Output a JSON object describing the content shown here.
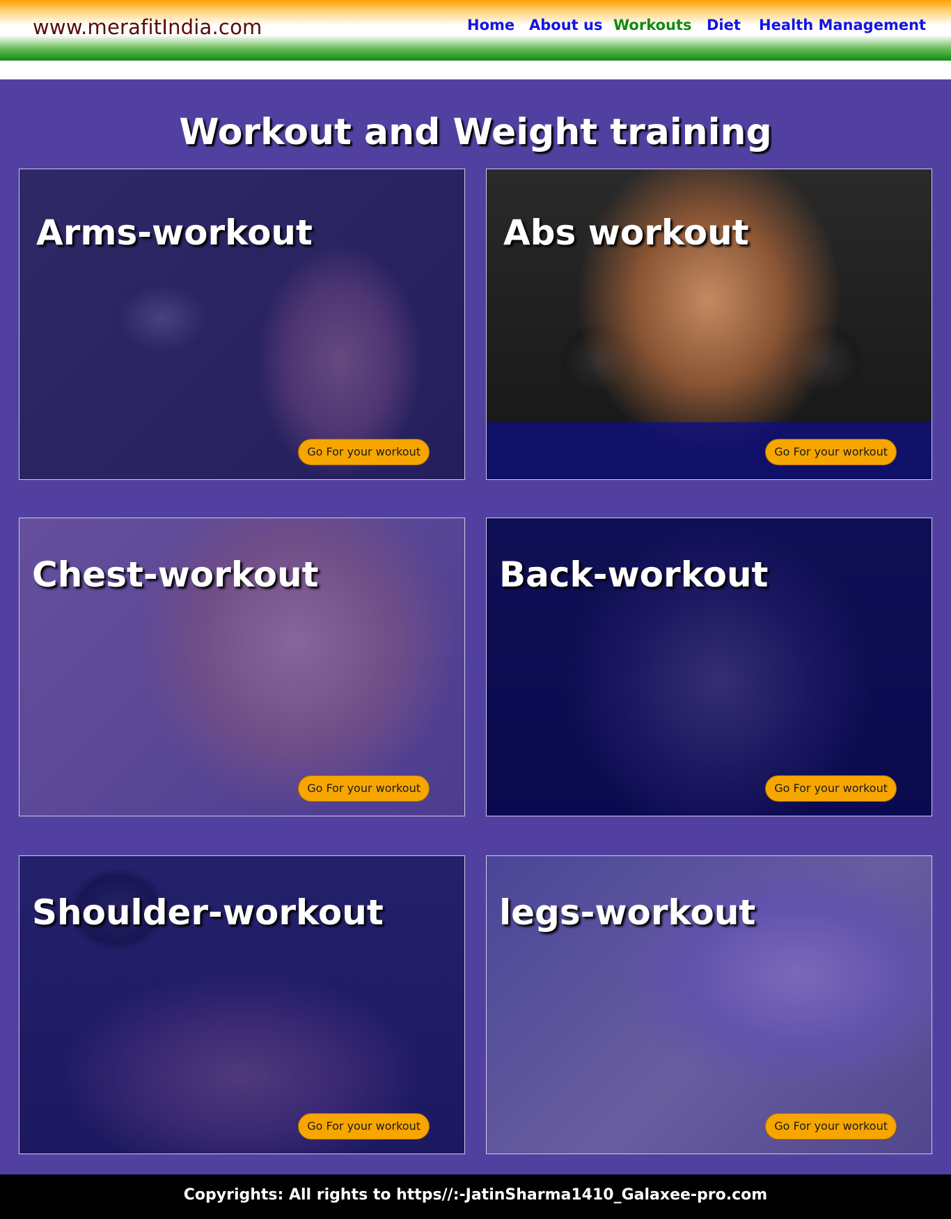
{
  "header": {
    "brand": "www.merafitIndia.com",
    "nav": [
      {
        "label": "Home",
        "active": false
      },
      {
        "label": "About us",
        "active": false
      },
      {
        "label": "Workouts",
        "active": true
      },
      {
        "label": "Diet",
        "active": false
      },
      {
        "label": "Health Management",
        "active": false
      }
    ]
  },
  "main": {
    "title": "Workout and Weight training",
    "cards": [
      {
        "title": "Arms-workout",
        "button": "Go For your workout"
      },
      {
        "title": "Abs workout",
        "button": "Go For your workout"
      },
      {
        "title": "Chest-workout",
        "button": "Go For your workout"
      },
      {
        "title": "Back-workout",
        "button": "Go For your workout"
      },
      {
        "title": "Shoulder-workout",
        "button": "Go For your workout"
      },
      {
        "title": "legs-workout",
        "button": "Go For your workout"
      }
    ]
  },
  "footer": {
    "text": "Copyrights: All rights to https//:-JatinSharma1410_Galaxee-pro.com"
  },
  "colors": {
    "header_saffron": "#ff9f00",
    "header_green": "#118a12",
    "nav_link": "#1414e6",
    "nav_active": "#118a12",
    "brand": "#5a0a0a",
    "main_bg": "#5240a0",
    "button_bg": "#f7a600",
    "footer_bg": "#000000"
  }
}
